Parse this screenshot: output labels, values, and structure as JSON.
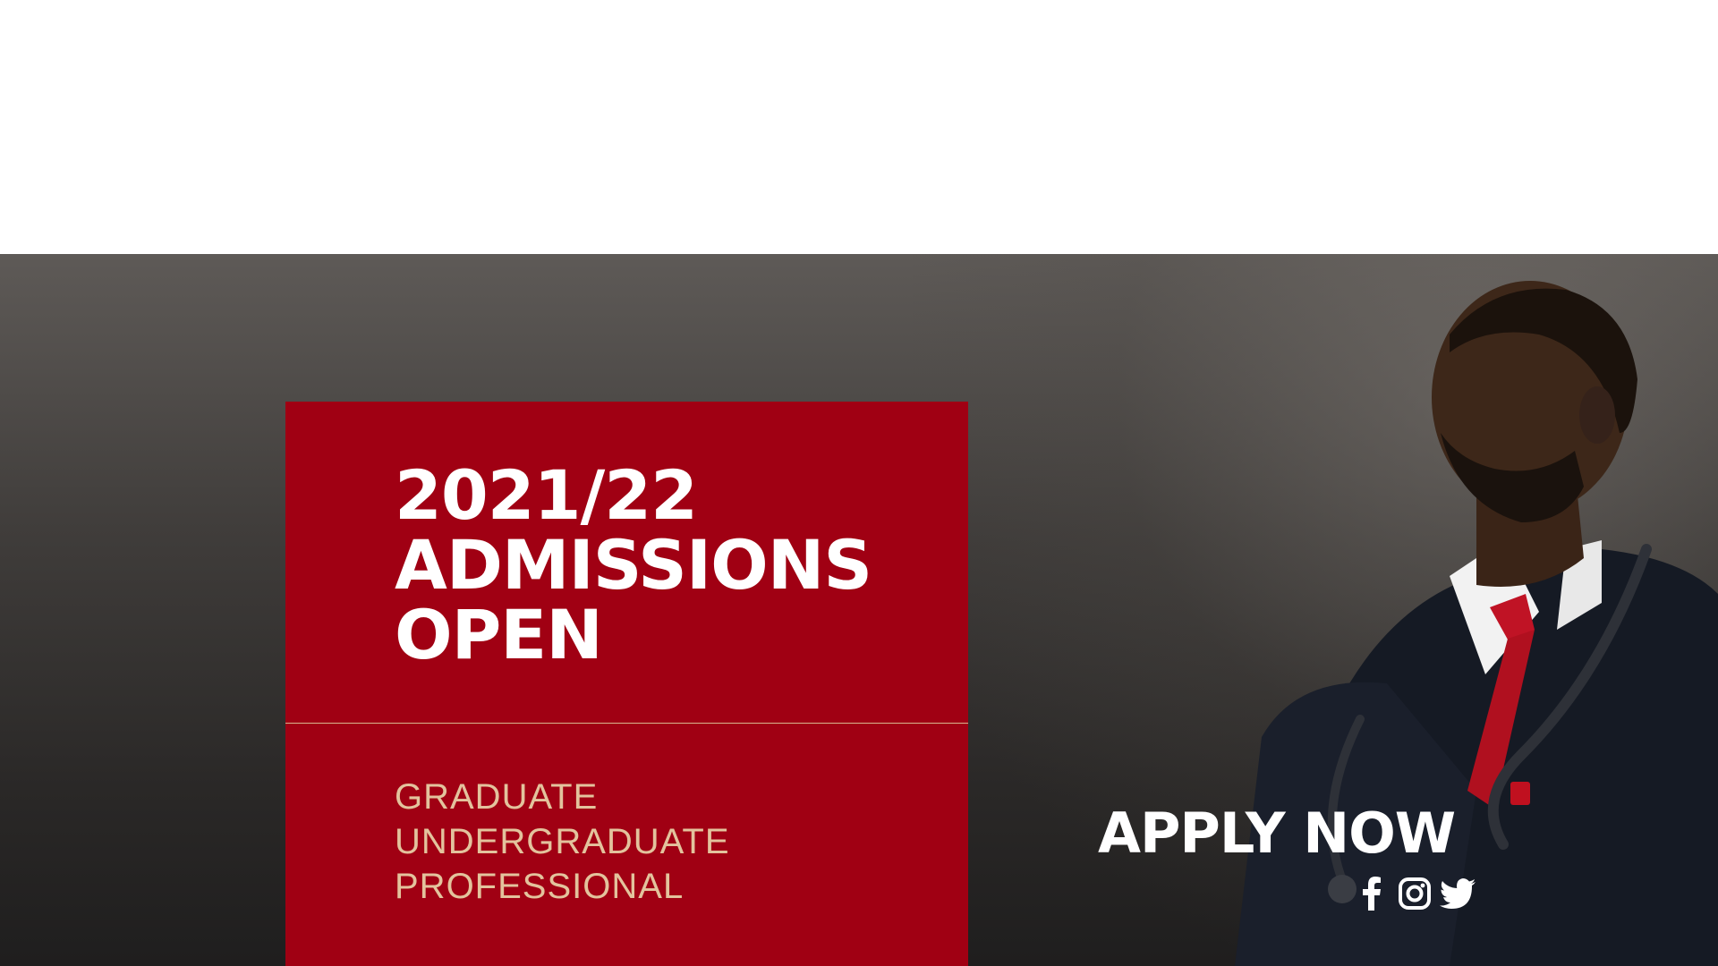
{
  "banner": {
    "headline_line1": "2021/22",
    "headline_line2": "ADMISSIONS",
    "headline_line3": "OPEN",
    "programs": [
      "GRADUATE",
      "UNDERGRADUATE",
      "PROFESSIONAL"
    ],
    "cta_label": "APPLY NOW",
    "socials": [
      "facebook-icon",
      "instagram-icon",
      "twitter-icon"
    ]
  },
  "colors": {
    "brand_red": "#a00013",
    "gold_text": "#e3c39d",
    "background_dark": "#2a2827",
    "white": "#ffffff"
  }
}
